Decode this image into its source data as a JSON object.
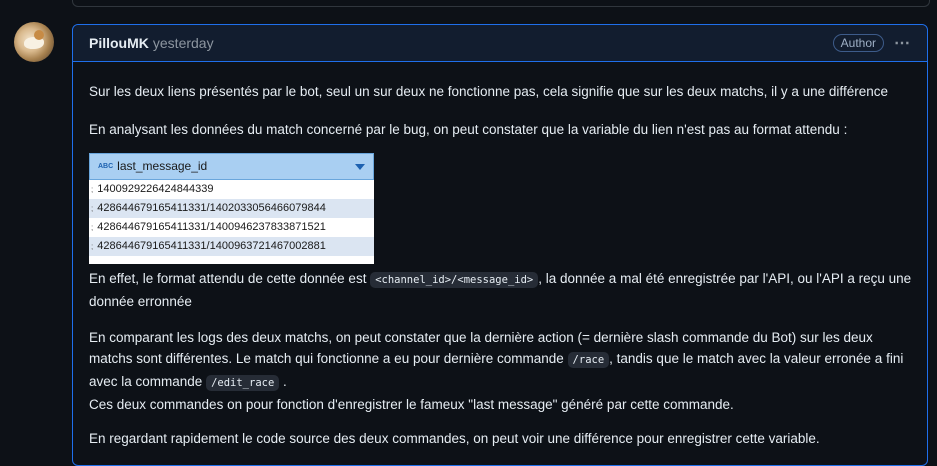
{
  "comment": {
    "author": "PillouMK",
    "timestamp": "yesterday",
    "badge": "Author",
    "more_icon": "⋯",
    "paragraph1": "Sur les deux liens présentés par le bot, seul un sur deux ne fonctionne pas, cela signifie que sur les deux matchs, il y a une différence",
    "paragraph2": "En analysant les données du match concerné par le bug, on peut constater que la variable du lien n'est pas au format attendu :",
    "paragraph3_a": "En effet, le format attendu de cette donnée est ",
    "paragraph3_code": "<channel_id>/<message_id>",
    "paragraph3_b": ", la donnée a mal été enregistrée par l'API, ou l'API a reçu une donnée erronnée",
    "paragraph4_a": "En comparant les logs des deux matchs, on peut constater que la dernière action (= dernière slash commande du Bot) sur les deux matchs sont différentes. Le match qui fonctionne a eu pour dernière commande ",
    "paragraph4_code1": "/race",
    "paragraph4_b": ", tandis que le match avec la valeur erronée a fini avec la commande ",
    "paragraph4_code2": "/edit_race",
    "paragraph4_c": " .",
    "paragraph4_d": "Ces deux commandes on pour fonction d'enregistrer le fameux \"last message\" généré par cette commande.",
    "paragraph5": "En regardant rapidement le code source des deux commandes, on peut voir une différence pour enregistrer cette variable."
  },
  "table": {
    "type_icon": "ABC",
    "column": "last_message_id",
    "rows": [
      "1400929226424844339",
      "428644679165411331/1402033056466079844",
      "428644679165411331/1400946237833871521",
      "428644679165411331/1400963721467002881"
    ]
  },
  "colors": {
    "accent_border": "#1f6feb",
    "background": "#0d1117"
  }
}
